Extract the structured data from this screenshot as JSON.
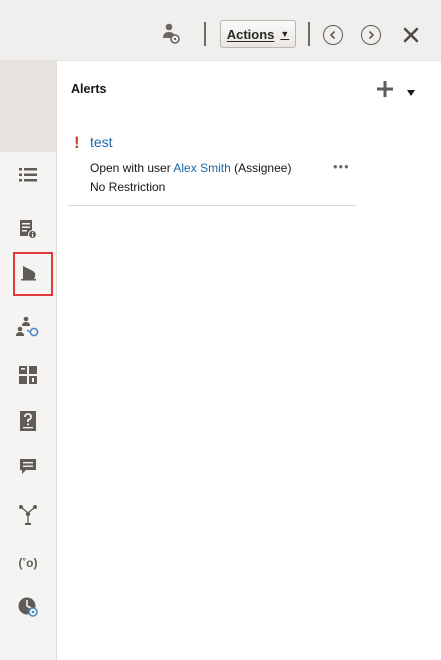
{
  "toolbar": {
    "actions_label": "Actions",
    "icons": [
      "user-settings-icon",
      "previous-icon",
      "next-icon",
      "close-icon"
    ]
  },
  "rail": {
    "items": [
      "list-icon",
      "document-info-icon",
      "alerts-bell-icon",
      "user-assignment-icon",
      "dashboard-icon",
      "help-question-icon",
      "comment-icon",
      "hierarchy-icon",
      "formula-icon",
      "clock-history-icon"
    ],
    "selected": "alerts-bell-icon"
  },
  "panel": {
    "title": "Alerts",
    "alerts": [
      {
        "title": "test",
        "line1_prefix": "Open with user ",
        "user": "Alex Smith",
        "line1_suffix": " (Assignee)",
        "line2": "No Restriction",
        "more": "•••"
      }
    ]
  },
  "colors": {
    "toolbar_bg": "#f1efed",
    "rail_bg": "#f5f4f2",
    "link": "#1a67a8",
    "alert_mark": "#c74634",
    "selection_box": "#e0393e"
  }
}
